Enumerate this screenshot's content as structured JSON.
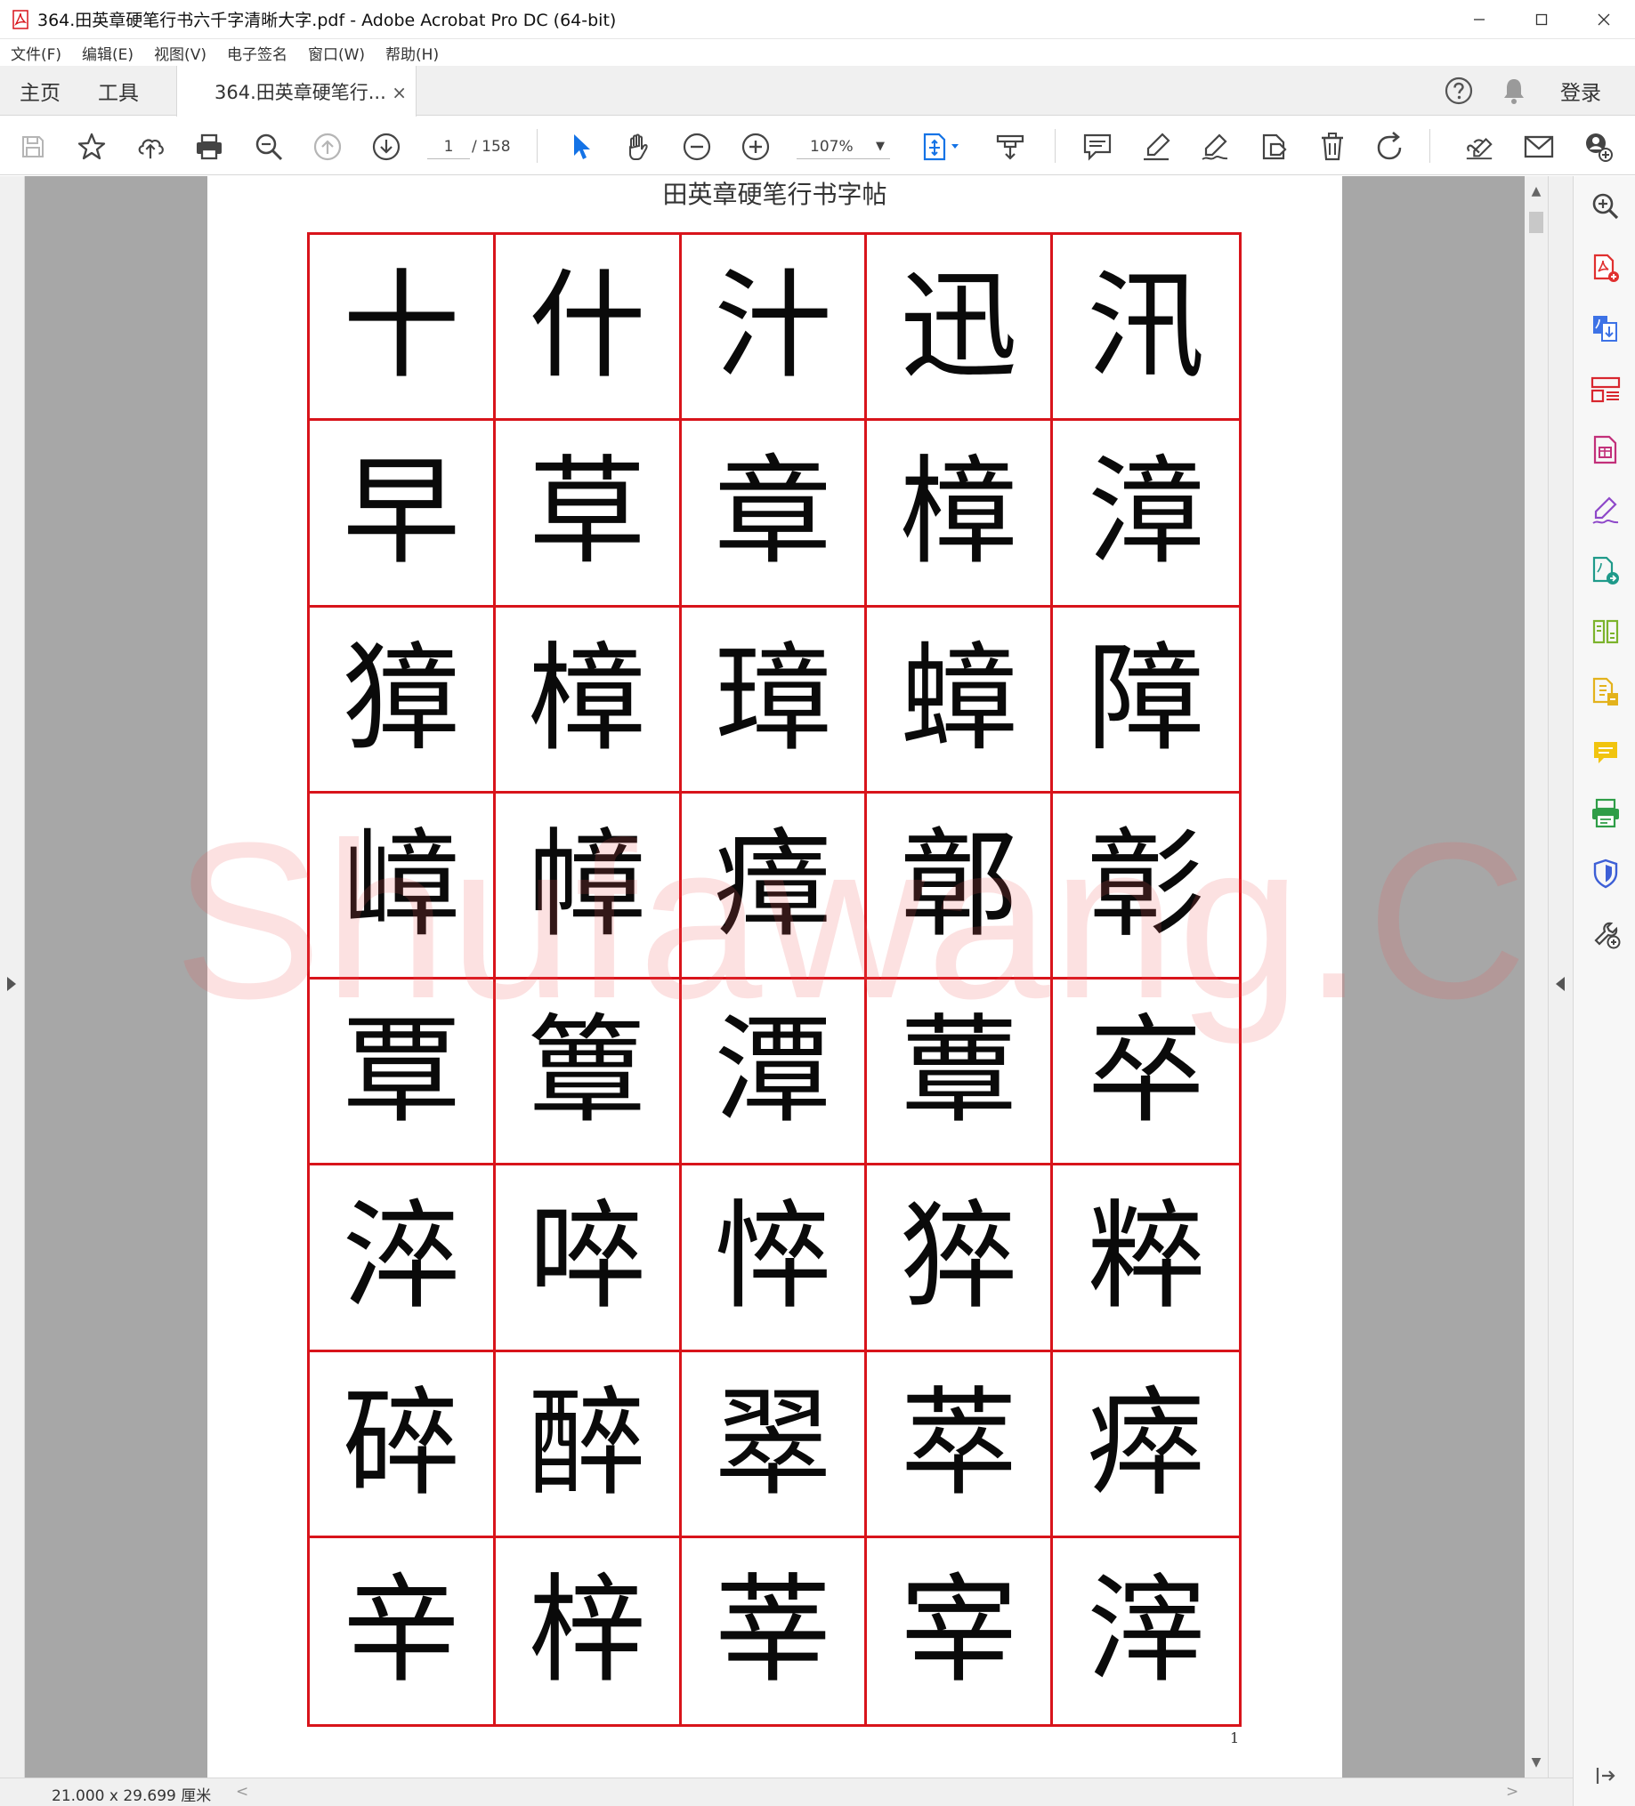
{
  "window": {
    "title": "364.田英章硬笔行书六千字清晰大字.pdf - Adobe Acrobat Pro DC (64-bit)"
  },
  "menu": [
    "文件(F)",
    "编辑(E)",
    "视图(V)",
    "电子签名",
    "窗口(W)",
    "帮助(H)"
  ],
  "tabs": {
    "home": "主页",
    "tools": "工具",
    "document": "364.田英章硬笔行...",
    "close_glyph": "×",
    "sign_in": "登录"
  },
  "toolbar": {
    "page_current": "1",
    "page_total": "/ 158",
    "zoom": "107%"
  },
  "document": {
    "header": "田英章硬笔行书字帖",
    "page_number": "1",
    "watermark": "Shufawang.CN",
    "characters": [
      "十",
      "什",
      "汁",
      "迅",
      "汛",
      "早",
      "草",
      "章",
      "樟",
      "漳",
      "獐",
      "樟",
      "璋",
      "蟑",
      "障",
      "嶂",
      "幛",
      "瘴",
      "鄣",
      "彰",
      "覃",
      "簟",
      "潭",
      "蕈",
      "卒",
      "淬",
      "啐",
      "悴",
      "猝",
      "粹",
      "碎",
      "醉",
      "翠",
      "萃",
      "瘁",
      "辛",
      "梓",
      "莘",
      "宰",
      "滓"
    ]
  },
  "status": {
    "page_size": "21.000 x 29.699 厘米"
  },
  "colors": {
    "grid_red": "#d8141b",
    "select_blue": "#1473e6"
  }
}
